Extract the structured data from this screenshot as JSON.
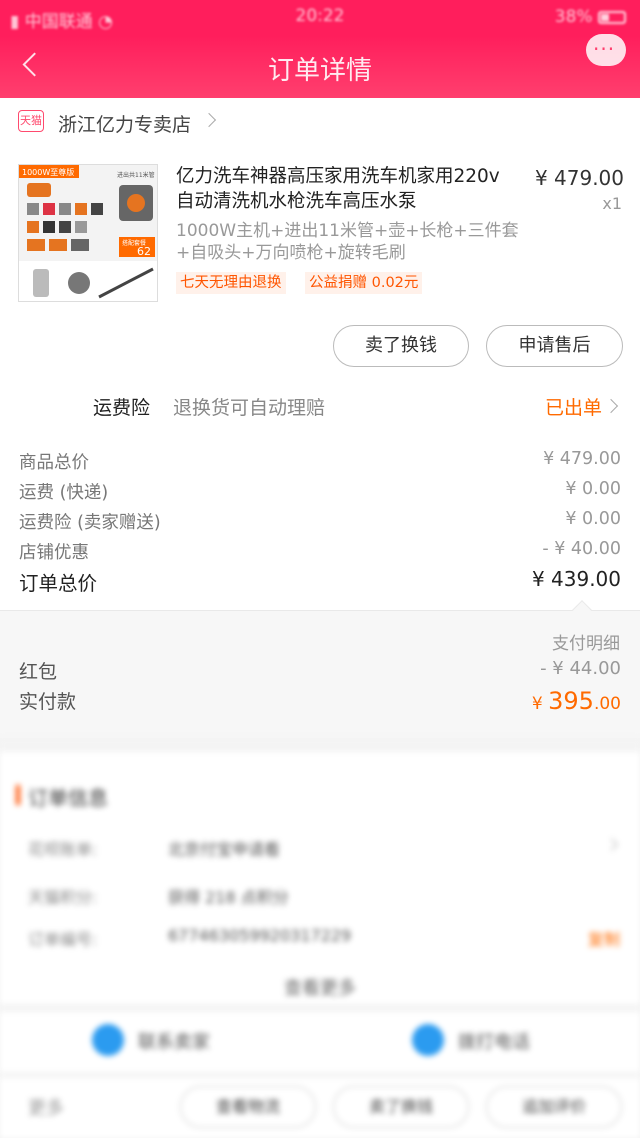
{
  "status_bar": {
    "carrier": "中国联通",
    "time": "20:22",
    "battery": "38%"
  },
  "nav": {
    "title": "订单详情"
  },
  "shop": {
    "badge": "天猫",
    "name": "浙江亿力专卖店"
  },
  "product": {
    "title": "亿力洗车神器高压家用洗车机家用220v自动清洗机水枪洗车高压水泵",
    "price": "¥ 479.00",
    "quantity": "x1",
    "sku": "1000W主机+进出11米管+壶+长枪+三件套+自吸头+万向喷枪+旋转毛刷",
    "tags": [
      "七天无理由退换",
      "公益捐赠 0.02元"
    ],
    "image_text": {
      "badge": "1000W至尊版",
      "corner": "进出共11米管",
      "promo": "搭配套餐",
      "promo_price": "62"
    }
  },
  "actions": {
    "sell_label": "卖了换钱",
    "aftersale_label": "申请售后"
  },
  "insurance": {
    "label": "运费险",
    "desc": "退换货可自动理赔",
    "status": "已出单"
  },
  "fees": [
    {
      "label": "商品总价",
      "value": "¥ 479.00"
    },
    {
      "label": "运费 (快递)",
      "value": "¥ 0.00"
    },
    {
      "label": "运费险 (卖家赠送)",
      "value": "¥ 0.00"
    },
    {
      "label": "店铺优惠",
      "value": "- ¥ 40.00"
    }
  ],
  "total": {
    "label": "订单总价",
    "value": "¥ 439.00"
  },
  "payment": {
    "detail_label": "支付明细",
    "redpack_label": "红包",
    "redpack_value": "- ¥ 44.00",
    "actual_label": "实付款",
    "actual_currency": "¥ ",
    "actual_int": "395",
    "actual_dec": ".00"
  },
  "order_info": {
    "title": "订单信息",
    "rows": [
      {
        "key": "花呗账单:",
        "value": "北京付宝申请看"
      },
      {
        "key": "天猫积分:",
        "value": "获得 218 点积分"
      },
      {
        "key": "订单编号:",
        "value": "677463059920317229",
        "action": "复制"
      }
    ],
    "more": "查看更多"
  },
  "contact": {
    "seller": "联系卖家",
    "phone": "拨打电话"
  },
  "bottom": {
    "more": "更多",
    "logistics": "查看物流",
    "sell": "卖了换钱",
    "review": "追加评价"
  },
  "colors": {
    "brand": "#ff1e5c",
    "accent": "#ff6a00",
    "tag_bg": "#fff1ea"
  }
}
